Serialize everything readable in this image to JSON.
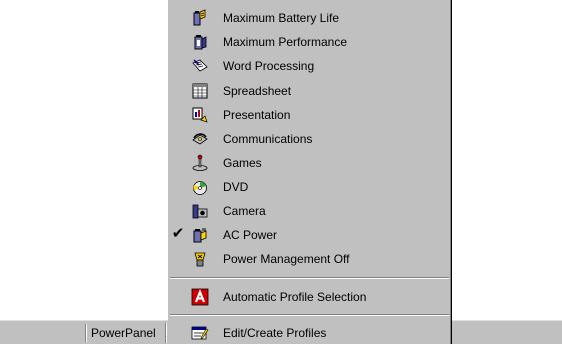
{
  "taskbar": {
    "label": "PowerPanel"
  },
  "menu": {
    "items": [
      {
        "label": "Maximum Battery Life",
        "icon": "battery-life-icon",
        "checked": false
      },
      {
        "label": "Maximum Performance",
        "icon": "performance-icon",
        "checked": false
      },
      {
        "label": "Word Processing",
        "icon": "word-processing-icon",
        "checked": false
      },
      {
        "label": "Spreadsheet",
        "icon": "spreadsheet-icon",
        "checked": false
      },
      {
        "label": "Presentation",
        "icon": "presentation-icon",
        "checked": false
      },
      {
        "label": "Communications",
        "icon": "communications-icon",
        "checked": false
      },
      {
        "label": "Games",
        "icon": "games-icon",
        "checked": false
      },
      {
        "label": "DVD",
        "icon": "dvd-icon",
        "checked": false
      },
      {
        "label": "Camera",
        "icon": "camera-icon",
        "checked": false
      },
      {
        "label": "AC Power",
        "icon": "ac-power-icon",
        "checked": true,
        "check_mark": "✔"
      },
      {
        "label": "Power Management Off",
        "icon": "power-off-icon",
        "checked": false
      }
    ],
    "auto_profile": {
      "label": "Automatic Profile Selection",
      "icon": "automatic-profile-icon"
    },
    "edit_profiles": {
      "label": "Edit/Create Profiles",
      "icon": "edit-profiles-icon"
    }
  }
}
